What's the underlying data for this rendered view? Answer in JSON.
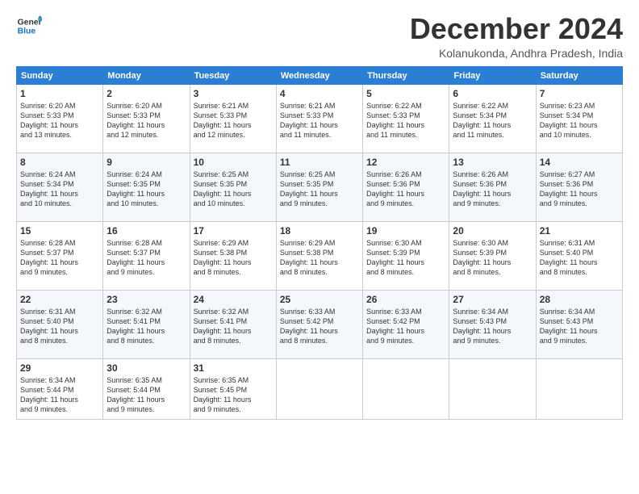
{
  "logo": {
    "line1": "General",
    "line2": "Blue"
  },
  "title": "December 2024",
  "location": "Kolanukonda, Andhra Pradesh, India",
  "headers": [
    "Sunday",
    "Monday",
    "Tuesday",
    "Wednesday",
    "Thursday",
    "Friday",
    "Saturday"
  ],
  "weeks": [
    [
      {
        "day": "1",
        "lines": [
          "Sunrise: 6:20 AM",
          "Sunset: 5:33 PM",
          "Daylight: 11 hours",
          "and 13 minutes."
        ]
      },
      {
        "day": "2",
        "lines": [
          "Sunrise: 6:20 AM",
          "Sunset: 5:33 PM",
          "Daylight: 11 hours",
          "and 12 minutes."
        ]
      },
      {
        "day": "3",
        "lines": [
          "Sunrise: 6:21 AM",
          "Sunset: 5:33 PM",
          "Daylight: 11 hours",
          "and 12 minutes."
        ]
      },
      {
        "day": "4",
        "lines": [
          "Sunrise: 6:21 AM",
          "Sunset: 5:33 PM",
          "Daylight: 11 hours",
          "and 11 minutes."
        ]
      },
      {
        "day": "5",
        "lines": [
          "Sunrise: 6:22 AM",
          "Sunset: 5:33 PM",
          "Daylight: 11 hours",
          "and 11 minutes."
        ]
      },
      {
        "day": "6",
        "lines": [
          "Sunrise: 6:22 AM",
          "Sunset: 5:34 PM",
          "Daylight: 11 hours",
          "and 11 minutes."
        ]
      },
      {
        "day": "7",
        "lines": [
          "Sunrise: 6:23 AM",
          "Sunset: 5:34 PM",
          "Daylight: 11 hours",
          "and 10 minutes."
        ]
      }
    ],
    [
      {
        "day": "8",
        "lines": [
          "Sunrise: 6:24 AM",
          "Sunset: 5:34 PM",
          "Daylight: 11 hours",
          "and 10 minutes."
        ]
      },
      {
        "day": "9",
        "lines": [
          "Sunrise: 6:24 AM",
          "Sunset: 5:35 PM",
          "Daylight: 11 hours",
          "and 10 minutes."
        ]
      },
      {
        "day": "10",
        "lines": [
          "Sunrise: 6:25 AM",
          "Sunset: 5:35 PM",
          "Daylight: 11 hours",
          "and 10 minutes."
        ]
      },
      {
        "day": "11",
        "lines": [
          "Sunrise: 6:25 AM",
          "Sunset: 5:35 PM",
          "Daylight: 11 hours",
          "and 9 minutes."
        ]
      },
      {
        "day": "12",
        "lines": [
          "Sunrise: 6:26 AM",
          "Sunset: 5:36 PM",
          "Daylight: 11 hours",
          "and 9 minutes."
        ]
      },
      {
        "day": "13",
        "lines": [
          "Sunrise: 6:26 AM",
          "Sunset: 5:36 PM",
          "Daylight: 11 hours",
          "and 9 minutes."
        ]
      },
      {
        "day": "14",
        "lines": [
          "Sunrise: 6:27 AM",
          "Sunset: 5:36 PM",
          "Daylight: 11 hours",
          "and 9 minutes."
        ]
      }
    ],
    [
      {
        "day": "15",
        "lines": [
          "Sunrise: 6:28 AM",
          "Sunset: 5:37 PM",
          "Daylight: 11 hours",
          "and 9 minutes."
        ]
      },
      {
        "day": "16",
        "lines": [
          "Sunrise: 6:28 AM",
          "Sunset: 5:37 PM",
          "Daylight: 11 hours",
          "and 9 minutes."
        ]
      },
      {
        "day": "17",
        "lines": [
          "Sunrise: 6:29 AM",
          "Sunset: 5:38 PM",
          "Daylight: 11 hours",
          "and 8 minutes."
        ]
      },
      {
        "day": "18",
        "lines": [
          "Sunrise: 6:29 AM",
          "Sunset: 5:38 PM",
          "Daylight: 11 hours",
          "and 8 minutes."
        ]
      },
      {
        "day": "19",
        "lines": [
          "Sunrise: 6:30 AM",
          "Sunset: 5:39 PM",
          "Daylight: 11 hours",
          "and 8 minutes."
        ]
      },
      {
        "day": "20",
        "lines": [
          "Sunrise: 6:30 AM",
          "Sunset: 5:39 PM",
          "Daylight: 11 hours",
          "and 8 minutes."
        ]
      },
      {
        "day": "21",
        "lines": [
          "Sunrise: 6:31 AM",
          "Sunset: 5:40 PM",
          "Daylight: 11 hours",
          "and 8 minutes."
        ]
      }
    ],
    [
      {
        "day": "22",
        "lines": [
          "Sunrise: 6:31 AM",
          "Sunset: 5:40 PM",
          "Daylight: 11 hours",
          "and 8 minutes."
        ]
      },
      {
        "day": "23",
        "lines": [
          "Sunrise: 6:32 AM",
          "Sunset: 5:41 PM",
          "Daylight: 11 hours",
          "and 8 minutes."
        ]
      },
      {
        "day": "24",
        "lines": [
          "Sunrise: 6:32 AM",
          "Sunset: 5:41 PM",
          "Daylight: 11 hours",
          "and 8 minutes."
        ]
      },
      {
        "day": "25",
        "lines": [
          "Sunrise: 6:33 AM",
          "Sunset: 5:42 PM",
          "Daylight: 11 hours",
          "and 8 minutes."
        ]
      },
      {
        "day": "26",
        "lines": [
          "Sunrise: 6:33 AM",
          "Sunset: 5:42 PM",
          "Daylight: 11 hours",
          "and 9 minutes."
        ]
      },
      {
        "day": "27",
        "lines": [
          "Sunrise: 6:34 AM",
          "Sunset: 5:43 PM",
          "Daylight: 11 hours",
          "and 9 minutes."
        ]
      },
      {
        "day": "28",
        "lines": [
          "Sunrise: 6:34 AM",
          "Sunset: 5:43 PM",
          "Daylight: 11 hours",
          "and 9 minutes."
        ]
      }
    ],
    [
      {
        "day": "29",
        "lines": [
          "Sunrise: 6:34 AM",
          "Sunset: 5:44 PM",
          "Daylight: 11 hours",
          "and 9 minutes."
        ]
      },
      {
        "day": "30",
        "lines": [
          "Sunrise: 6:35 AM",
          "Sunset: 5:44 PM",
          "Daylight: 11 hours",
          "and 9 minutes."
        ]
      },
      {
        "day": "31",
        "lines": [
          "Sunrise: 6:35 AM",
          "Sunset: 5:45 PM",
          "Daylight: 11 hours",
          "and 9 minutes."
        ]
      },
      {
        "day": "",
        "lines": []
      },
      {
        "day": "",
        "lines": []
      },
      {
        "day": "",
        "lines": []
      },
      {
        "day": "",
        "lines": []
      }
    ]
  ]
}
